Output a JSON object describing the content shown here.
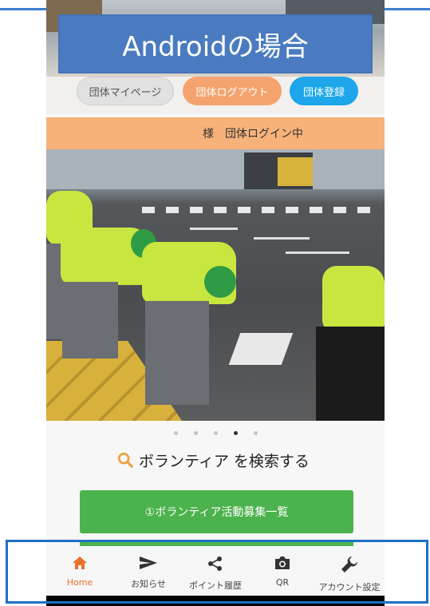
{
  "banner": {
    "text": "Androidの場合"
  },
  "header_buttons": {
    "mypage": "団体マイページ",
    "logout": "団体ログアウト",
    "register": "団体登録"
  },
  "status": {
    "text": "様　団体ログイン中"
  },
  "carousel": {
    "count": 5,
    "active_index": 3
  },
  "search": {
    "title": "ボランティア を検索する"
  },
  "actions": {
    "recruit_list": "①ボランティア活動募集一覧"
  },
  "nav": {
    "items": [
      {
        "label": "Home",
        "icon": "home-icon",
        "active": true
      },
      {
        "label": "お知らせ",
        "icon": "send-icon",
        "active": false
      },
      {
        "label": "ポイント履歴",
        "icon": "share-icon",
        "active": false
      },
      {
        "label": "QR",
        "icon": "camera-icon",
        "active": false
      },
      {
        "label": "アカウント設定",
        "icon": "wrench-icon",
        "active": false
      }
    ]
  },
  "colors": {
    "banner": "#4a7bc0",
    "logout": "#f4a36e",
    "register": "#1da7ea",
    "status_bar": "#f7b27a",
    "green_button": "#4cb24d",
    "active_nav": "#e8702a",
    "highlight": "#1f6fc4"
  }
}
